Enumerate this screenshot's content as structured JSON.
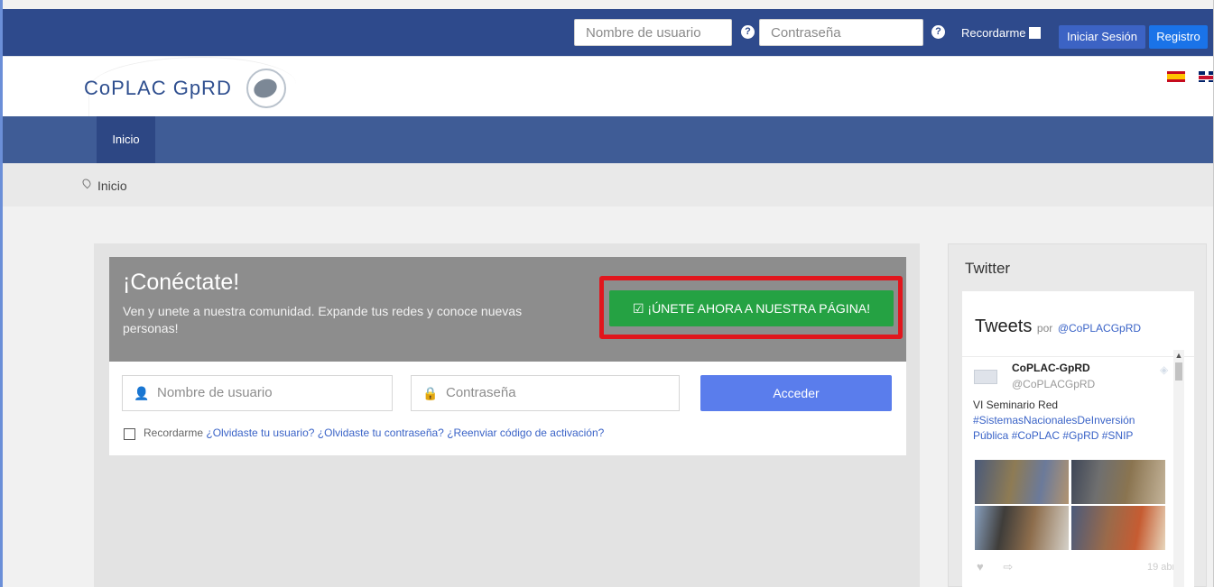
{
  "topbar": {
    "username_placeholder": "Nombre de usuario",
    "password_placeholder": "Contraseña",
    "help_icon": "question-circle-icon",
    "remember_label": "Recordarme",
    "login_button": "Iniciar Sesión",
    "register_button": "Registro",
    "colors": {
      "bar": "#2e4a8c",
      "register": "#1a73e8",
      "login": "#3c63c4"
    }
  },
  "brand": {
    "logo_text": "CoPLAC GpRD",
    "languages": [
      "es-flag-icon",
      "uk-flag-icon"
    ]
  },
  "nav": {
    "items": [
      {
        "label": "Inicio",
        "active": true
      }
    ]
  },
  "breadcrumb": {
    "icon": "map-pin-icon",
    "label": "Inicio"
  },
  "hero": {
    "title": "¡Conéctate!",
    "description": "Ven y unete a nuestra comunidad. Expande tus redes y conoce nuevas personas!",
    "join_button": "¡ÚNETE AHORA A NUESTRA PÁGINA!",
    "join_icon": "check-calendar-icon",
    "colors": {
      "hero": "#8d8d8d",
      "join": "#25a243",
      "highlight": "#e1161d"
    }
  },
  "login_form": {
    "username_placeholder": "Nombre de usuario",
    "password_placeholder": "Contraseña",
    "submit": "Acceder",
    "remember": "Recordarme",
    "forgot_user": "¿Olvidaste tu usuario?",
    "forgot_password": "¿Olvidaste tu contraseña?",
    "resend_code": "¿Reenviar código de activación?"
  },
  "twitter": {
    "panel_title": "Twitter",
    "widget_title": "Tweets",
    "por": "por",
    "handle_link": "@CoPLACGpRD",
    "tweet": {
      "name": "CoPLAC-GpRD",
      "handle": "@CoPLACGpRD",
      "text_plain": "VI Seminario Red",
      "hashtags": "#SistemasNacionalesDeInversión Pública #CoPLAC #GpRD #SNIP",
      "date": "19 abr"
    }
  }
}
